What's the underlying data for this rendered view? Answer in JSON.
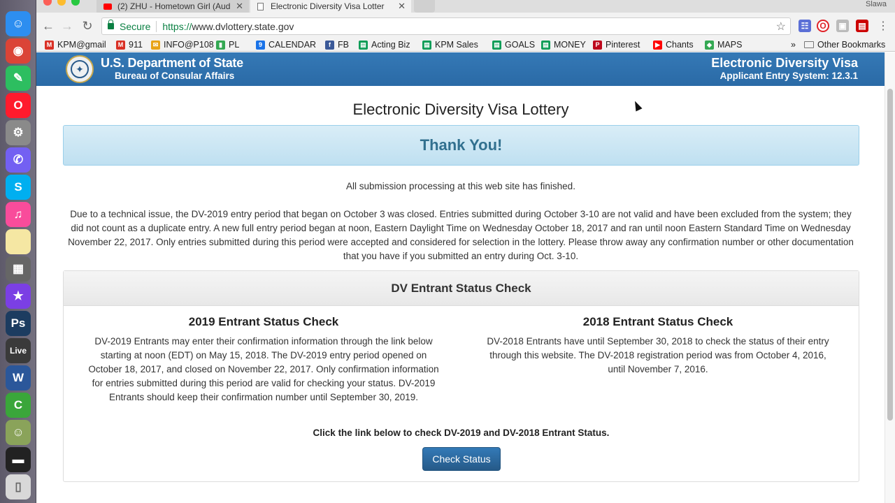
{
  "browser": {
    "tabs": [
      {
        "label": "(2) ZHU - Hometown Girl (Aud"
      },
      {
        "label": "Electronic Diversity Visa Lotter"
      }
    ],
    "user": "Slawa",
    "secure_label": "Secure",
    "url_scheme": "https://",
    "url_host": "www.dvlottery.state.gov"
  },
  "bookmarks": [
    {
      "label": "KPM@gmail",
      "color": "#d93025",
      "glyph": "M"
    },
    {
      "label": "911",
      "color": "#d93025",
      "glyph": "M"
    },
    {
      "label": "INFO@P108",
      "color": "#e8a317",
      "glyph": "✉"
    },
    {
      "label": "PL",
      "color": "#34a853",
      "glyph": "▮"
    },
    {
      "label": "CALENDAR",
      "color": "#1a73e8",
      "glyph": "9"
    },
    {
      "label": "FB",
      "color": "#3b5998",
      "glyph": "f"
    },
    {
      "label": "Acting Biz",
      "color": "#0f9d58",
      "glyph": "▤"
    },
    {
      "label": "KPM Sales",
      "color": "#0f9d58",
      "glyph": "▤"
    },
    {
      "label": "GOALS",
      "color": "#0f9d58",
      "glyph": "▤"
    },
    {
      "label": "MONEY",
      "color": "#0f9d58",
      "glyph": "▤"
    },
    {
      "label": "Pinterest",
      "color": "#bd081c",
      "glyph": "P"
    },
    {
      "label": "Chants",
      "color": "#ff0000",
      "glyph": "▶"
    },
    {
      "label": "MAPS",
      "color": "#34a853",
      "glyph": "◆"
    }
  ],
  "other_bookmarks": "Other Bookmarks",
  "overflow": "»",
  "header": {
    "department": "U.S. Department of State",
    "bureau": "Bureau of Consular Affairs",
    "system_title": "Electronic Diversity Visa",
    "system_version": "Applicant Entry System: 12.3.1"
  },
  "main": {
    "title": "Electronic Diversity Visa Lottery",
    "thank_you": "Thank You!",
    "processing_note": "All submission processing at this web site has finished.",
    "notice": "Due to a technical issue, the DV-2019 entry period that began on October 3 was closed. Entries submitted during October 3-10 are not valid and have been excluded from the system; they did not count as a duplicate entry. A new full entry period began at noon, Eastern Daylight Time on Wednesday October 18, 2017 and ran until noon Eastern Standard Time on Wednesday November 22, 2017. Only entries submitted during this period were accepted and considered for selection in the lottery. Please throw away any confirmation number or other documentation that you have if you submitted an entry during Oct. 3-10."
  },
  "status_panel": {
    "heading": "DV Entrant Status Check",
    "left": {
      "title": "2019 Entrant Status Check",
      "body": "DV-2019 Entrants may enter their confirmation information through the link below starting at noon (EDT) on May 15, 2018. The DV-2019 entry period opened on October 18, 2017, and closed on November 22, 2017. Only confirmation information for entries submitted during this period are valid for checking your status. DV-2019 Entrants should keep their confirmation number until September 30, 2019."
    },
    "right": {
      "title": "2018 Entrant Status Check",
      "body": "DV-2018 Entrants have until September 30, 2018 to check the status of their entry through this website. The DV-2018 registration period was from October 4, 2016, until November 7, 2016."
    },
    "cta_text": "Click the link below to check DV-2019 and DV-2018 Entrant Status.",
    "button_label": "Check Status"
  },
  "dock": [
    {
      "name": "finder-icon",
      "color": "#2d8ef0",
      "glyph": "☺"
    },
    {
      "name": "chrome-icon",
      "color": "#db4437",
      "glyph": "◉"
    },
    {
      "name": "evernote-icon",
      "color": "#2dbe60",
      "glyph": "✎"
    },
    {
      "name": "opera-icon",
      "color": "#ff1b2d",
      "glyph": "O"
    },
    {
      "name": "system-preferences-icon",
      "color": "#8a8a8a",
      "glyph": "⚙"
    },
    {
      "name": "viber-icon",
      "color": "#7360f2",
      "glyph": "✆"
    },
    {
      "name": "skype-icon",
      "color": "#00aff0",
      "glyph": "S"
    },
    {
      "name": "itunes-icon",
      "color": "#f94c9b",
      "glyph": "♫"
    },
    {
      "name": "notes-icon",
      "color": "#f5e7a3",
      "glyph": ""
    },
    {
      "name": "calculator-icon",
      "color": "#666666",
      "glyph": "▦"
    },
    {
      "name": "imovie-icon",
      "color": "#7b3fe4",
      "glyph": "★"
    },
    {
      "name": "photoshop-icon",
      "color": "#1c3c60",
      "glyph": "Ps"
    },
    {
      "name": "live-icon",
      "color": "#3a3a3a",
      "glyph": "Live"
    },
    {
      "name": "word-icon",
      "color": "#2b579a",
      "glyph": "W"
    },
    {
      "name": "camtasia-icon",
      "color": "#3aa63a",
      "glyph": "C"
    },
    {
      "name": "preview-icon",
      "color": "#8aa35a",
      "glyph": "☺"
    },
    {
      "name": "terminal-icon",
      "color": "#222222",
      "glyph": "▬"
    },
    {
      "name": "trash-icon",
      "color": "#d8d8d8",
      "glyph": "▯"
    }
  ]
}
